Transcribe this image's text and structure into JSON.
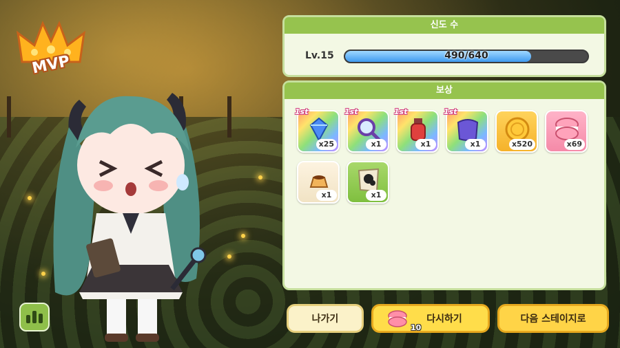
{
  "mvp": {
    "label": "MVP"
  },
  "devotion": {
    "title": "신도 수",
    "level_label": "Lv.15",
    "progress_text": "490/640",
    "current": 490,
    "max": 640
  },
  "reward": {
    "title": "보상",
    "first_badge": "1st",
    "items": [
      {
        "name": "blue-gem",
        "qty": "x25",
        "first": true,
        "bg": "rainbow"
      },
      {
        "name": "magnifier",
        "qty": "x1",
        "first": true,
        "bg": "rainbow"
      },
      {
        "name": "potion-bottle",
        "qty": "x1",
        "first": true,
        "bg": "rainbow"
      },
      {
        "name": "purple-cloth",
        "qty": "x1",
        "first": true,
        "bg": "rainbow"
      },
      {
        "name": "gold-coin",
        "qty": "x520",
        "first": false,
        "bg": "gold"
      },
      {
        "name": "macaron",
        "qty": "x69",
        "first": false,
        "bg": "pink"
      },
      {
        "name": "pudding",
        "qty": "x1",
        "first": false,
        "bg": "beige"
      },
      {
        "name": "map-scroll",
        "qty": "x1",
        "first": false,
        "bg": "green"
      }
    ]
  },
  "buttons": {
    "exit": "나가기",
    "retry": "다시하기",
    "retry_cost": "10",
    "next": "다음 스테이지로"
  },
  "colors": {
    "panel_header": "#96c34e",
    "panel_bg": "#f3f8e4",
    "progress_fill": "#3f9af0",
    "button_gold": "#ffdd4a"
  }
}
